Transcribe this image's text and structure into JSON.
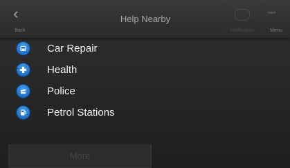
{
  "header": {
    "back_label": "Back",
    "title": "Help Nearby",
    "notification_label": "Notification",
    "menu_label": "Menu"
  },
  "items": [
    {
      "label": "Car Repair",
      "icon": "car-repair-icon"
    },
    {
      "label": "Health",
      "icon": "health-cross-icon"
    },
    {
      "label": "Police",
      "icon": "police-icon"
    },
    {
      "label": "Petrol Stations",
      "icon": "fuel-pump-icon"
    }
  ],
  "footer": {
    "more_label": "More"
  },
  "colors": {
    "accent": "#1e6fc8",
    "background": "#262626",
    "text": "#f2f2f2"
  }
}
